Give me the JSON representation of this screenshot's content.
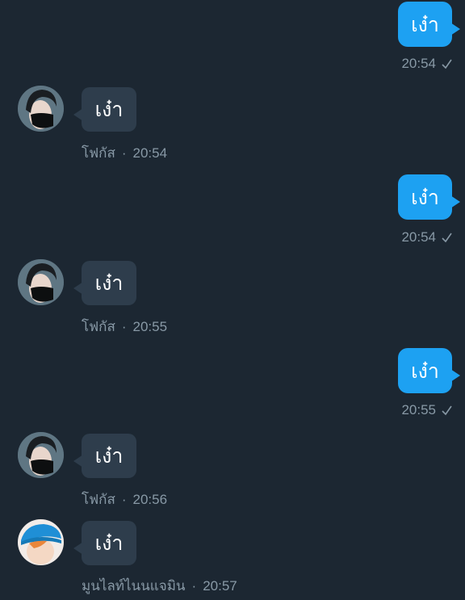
{
  "messages": [
    {
      "direction": "out",
      "text": "เง๋า",
      "time": "20:54",
      "status_icon": "sent-check-icon"
    },
    {
      "direction": "in",
      "text": "เง๋า",
      "sender": "โฟกัส",
      "separator": "·",
      "time": "20:54",
      "avatar": "masked-user-avatar"
    },
    {
      "direction": "out",
      "text": "เง๋า",
      "time": "20:54",
      "status_icon": "sent-check-icon"
    },
    {
      "direction": "in",
      "text": "เง๋า",
      "sender": "โฟกัส",
      "separator": "·",
      "time": "20:55",
      "avatar": "masked-user-avatar"
    },
    {
      "direction": "out",
      "text": "เง๋า",
      "time": "20:55",
      "status_icon": "sent-check-icon"
    },
    {
      "direction": "in",
      "text": "เง๋า",
      "sender": "โฟกัส",
      "separator": "·",
      "time": "20:56",
      "avatar": "masked-user-avatar"
    },
    {
      "direction": "in",
      "text": "เง๋า",
      "sender": "มูนไลท์ไนนแจมิน",
      "separator": "·",
      "time": "20:57",
      "avatar": "blue-cap-user-avatar"
    }
  ],
  "colors": {
    "background": "#1c2732",
    "outgoing_bubble": "#1da1f2",
    "incoming_bubble": "#2e3d4c",
    "meta_text": "#8899a6"
  }
}
